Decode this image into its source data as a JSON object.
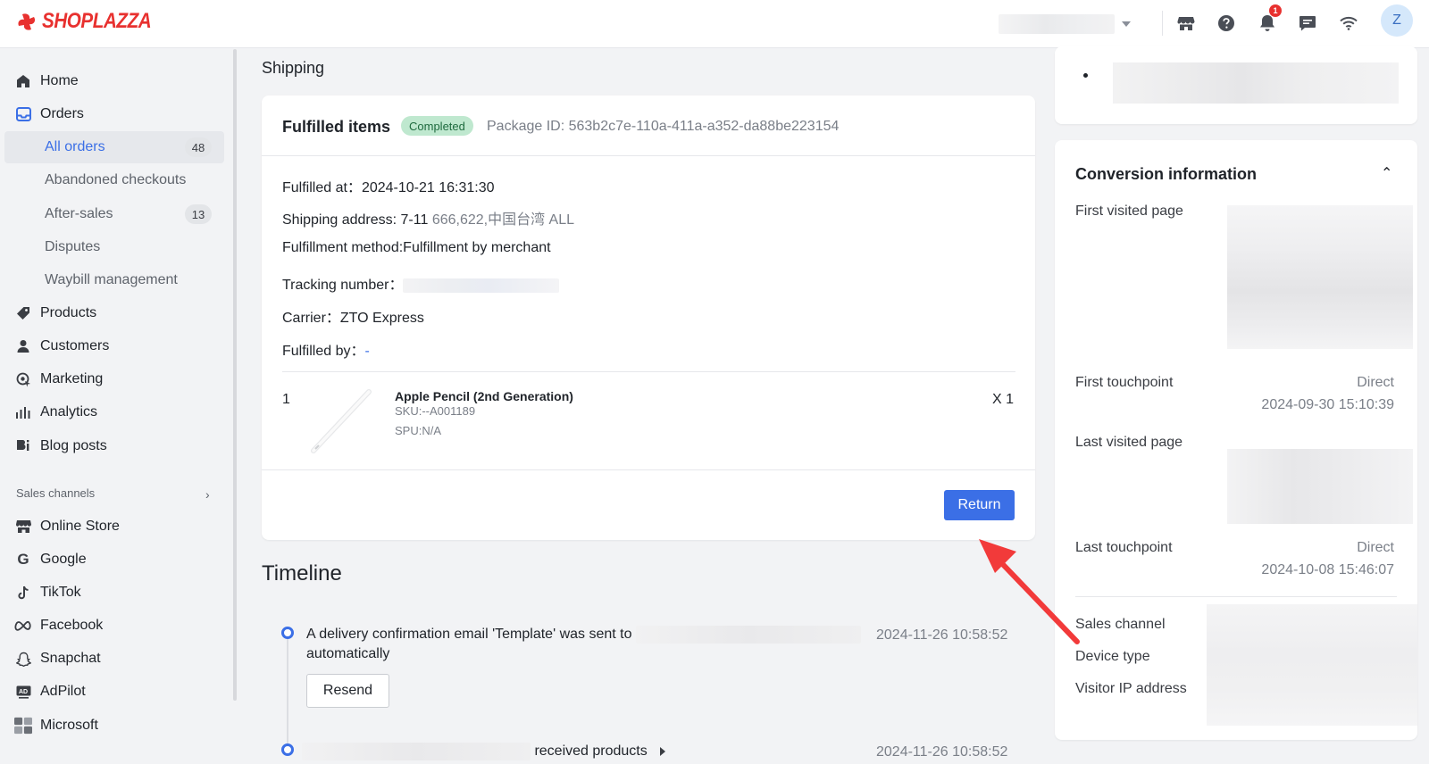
{
  "app": {
    "brand": "SHOPLAZZA",
    "avatar_initial": "Z",
    "notification_count": "1"
  },
  "topbar": {
    "icons": [
      "store-icon",
      "help-icon",
      "bell-icon",
      "chat-icon",
      "wifi-icon"
    ]
  },
  "sidebar": {
    "items": [
      {
        "label": "Home",
        "icon": "home-icon"
      },
      {
        "label": "Orders",
        "icon": "orders-icon"
      },
      {
        "label": "Products",
        "icon": "tag-icon"
      },
      {
        "label": "Customers",
        "icon": "person-icon"
      },
      {
        "label": "Marketing",
        "icon": "marketing-icon"
      },
      {
        "label": "Analytics",
        "icon": "bar-chart-icon"
      },
      {
        "label": "Blog posts",
        "icon": "blog-icon"
      }
    ],
    "order_subitems": [
      {
        "label": "All orders",
        "count": "48"
      },
      {
        "label": "Abandoned checkouts"
      },
      {
        "label": "After-sales",
        "count": "13"
      },
      {
        "label": "Disputes"
      },
      {
        "label": "Waybill management"
      }
    ],
    "sales_channels_label": "Sales channels",
    "channels": [
      {
        "label": "Online Store",
        "icon": "store-icon"
      },
      {
        "label": "Google",
        "icon": "google-icon"
      },
      {
        "label": "TikTok",
        "icon": "tiktok-icon"
      },
      {
        "label": "Facebook",
        "icon": "meta-icon"
      },
      {
        "label": "Snapchat",
        "icon": "ghost-icon"
      },
      {
        "label": "AdPilot",
        "icon": "ad-icon"
      },
      {
        "label": "Microsoft",
        "icon": "microsoft-icon"
      }
    ]
  },
  "main": {
    "section_title": "Shipping",
    "fulfilled": {
      "title": "Fulfilled items",
      "status": "Completed",
      "package_id": "Package ID: 563b2c7e-110a-411a-a352-da88be223154",
      "fulfilled_at_label": "Fulfilled at：",
      "fulfilled_at": "2024-10-21 16:31:30",
      "shipping_address_label": "Shipping address: 7-11",
      "shipping_address": "666,622,中国台湾 ALL",
      "method": "Fulfillment method:Fulfillment by merchant",
      "tracking_label": "Tracking number：",
      "carrier": "Carrier：ZTO Express",
      "fulfilled_by_label": "Fulfilled by：",
      "fulfilled_by": "-",
      "product": {
        "index": "1",
        "name": "Apple Pencil (2nd Generation)",
        "sku": "SKU:--A001189",
        "spu": "SPU:N/A",
        "qty": "X 1"
      },
      "return_label": "Return"
    },
    "timeline": {
      "title": "Timeline",
      "events": [
        {
          "text_before": "A delivery confirmation email 'Template' was sent to",
          "text_after": "automatically",
          "time": "2024-11-26 10:58:52",
          "button": "Resend"
        },
        {
          "text": "received products",
          "time": "2024-11-26 10:58:52"
        }
      ]
    }
  },
  "conversion": {
    "title": "Conversion information",
    "first_visited_page": "First visited page",
    "first_touchpoint_label": "First touchpoint",
    "first_touchpoint": "Direct",
    "first_touchpoint_time": "2024-09-30 15:10:39",
    "last_visited_page": "Last visited page",
    "last_touchpoint_label": "Last touchpoint",
    "last_touchpoint": "Direct",
    "last_touchpoint_time": "2024-10-08 15:46:07",
    "sales_channel": "Sales channel",
    "device_type": "Device type",
    "visitor_ip": "Visitor IP address"
  },
  "colors": {
    "brand": "#e8312f",
    "accent": "#3b6fe6",
    "success_bg": "#bfe8cf",
    "annotation_arrow": "#f23a3a"
  }
}
